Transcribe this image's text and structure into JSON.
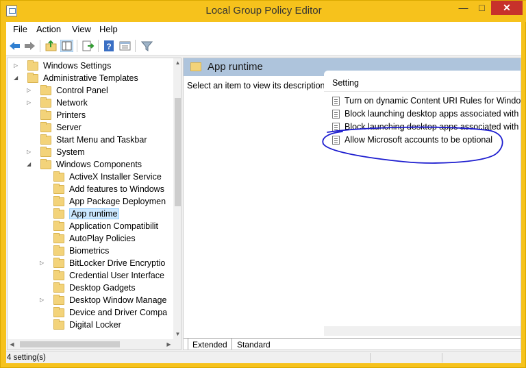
{
  "window": {
    "title": "Local Group Policy Editor",
    "min_icon": "minimize-icon",
    "max_icon": "maximize-icon",
    "close_icon": "close-icon"
  },
  "menu": [
    "File",
    "Action",
    "View",
    "Help"
  ],
  "toolbar_icons": [
    "back-icon",
    "forward-icon",
    "up-folder-icon",
    "show-hide-tree-icon",
    "export-list-icon",
    "help-icon",
    "properties-icon",
    "filter-icon"
  ],
  "tree": {
    "items": [
      {
        "label": "Windows Settings",
        "expander": "collapsed"
      },
      {
        "label": "Administrative Templates",
        "expander": "expanded"
      },
      {
        "label": "Control Panel",
        "expander": "collapsed"
      },
      {
        "label": "Network",
        "expander": "collapsed"
      },
      {
        "label": "Printers",
        "expander": "none"
      },
      {
        "label": "Server",
        "expander": "none"
      },
      {
        "label": "Start Menu and Taskbar",
        "expander": "none"
      },
      {
        "label": "System",
        "expander": "collapsed"
      },
      {
        "label": "Windows Components",
        "expander": "expanded"
      },
      {
        "label": "ActiveX Installer Service",
        "expander": "none"
      },
      {
        "label": "Add features to Windows",
        "expander": "none"
      },
      {
        "label": "App Package Deploymen",
        "expander": "none"
      },
      {
        "label": "App runtime",
        "expander": "none",
        "selected": true
      },
      {
        "label": "Application Compatibilit",
        "expander": "none"
      },
      {
        "label": "AutoPlay Policies",
        "expander": "none"
      },
      {
        "label": "Biometrics",
        "expander": "none"
      },
      {
        "label": "BitLocker Drive Encryptio",
        "expander": "collapsed"
      },
      {
        "label": "Credential User Interface",
        "expander": "none"
      },
      {
        "label": "Desktop Gadgets",
        "expander": "none"
      },
      {
        "label": "Desktop Window Manage",
        "expander": "collapsed"
      },
      {
        "label": "Device and Driver Compa",
        "expander": "none"
      },
      {
        "label": "Digital Locker",
        "expander": "none"
      }
    ]
  },
  "right_pane": {
    "title": "App runtime",
    "description": "Select an item to view its description.",
    "column_header": "Setting",
    "settings": [
      "Turn on dynamic Content URI Rules for Windows",
      "Block launching desktop apps associated with a f",
      "Block launching desktop apps associated with a U",
      "Allow Microsoft accounts to be optional"
    ],
    "tabs": [
      "Extended",
      "Standard"
    ]
  },
  "status": {
    "text": "4 setting(s)"
  },
  "colors": {
    "title_bar": "#f6c21c",
    "close_button": "#c7312b",
    "header_band": "#aec4dc",
    "selection": "#cce8ff",
    "annotation": "#1c1ccf"
  }
}
